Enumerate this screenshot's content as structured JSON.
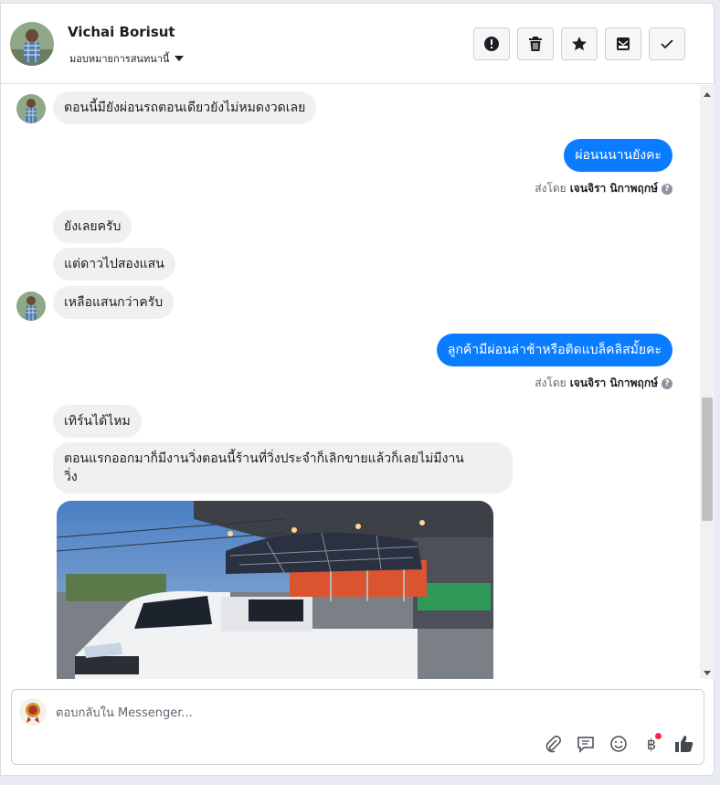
{
  "header": {
    "contact_name": "Vichai Borisut",
    "assign_label": "มอบหมายการสนทนานี้",
    "actions": [
      "spam-icon",
      "trash-icon",
      "star-icon",
      "inbox-icon",
      "check-icon"
    ]
  },
  "messages": [
    {
      "from": "in",
      "text": "ตอนนี้มียังผ่อนรถตอนเดียวยังไม่หมดงวดเลย"
    },
    {
      "from": "out",
      "text": "ผ่อนนนานยังคะ",
      "sent_by_prefix": "ส่งโดย",
      "sent_by_name": "เจนจิรา นิกาพฤกษ์"
    },
    {
      "from": "in",
      "text": "ยังเลยครับ"
    },
    {
      "from": "in",
      "text": "แต่ดาวไปสองแสน"
    },
    {
      "from": "in",
      "text": "เหลือแสนกว่าครับ"
    },
    {
      "from": "out",
      "text": "ลูกค้ามีผ่อนล่าช้าหรือติดแบล็คลิสมั้ยคะ",
      "sent_by_prefix": "ส่งโดย",
      "sent_by_name": "เจนจิรา นิกาพฤกษ์"
    },
    {
      "from": "in",
      "text": "เทิร์นได้ไหม"
    },
    {
      "from": "in",
      "text": "ตอนแรกออกมาก็มีงานวิ่งตอนนี้ร้านที่วิ่งประจำก็เลิกขายแล้วก็เลยไม่มีงาน",
      "text_line2": "วิ่ง"
    }
  ],
  "composer": {
    "placeholder": "ตอบกลับใน Messenger...",
    "tools": [
      "paperclip-icon",
      "saved-reply-icon",
      "emoji-icon",
      "baht-payment-icon",
      "thumbs-up-icon"
    ],
    "baht_symbol": "฿"
  },
  "colors": {
    "outgoing_bubble": "#0a7cff",
    "incoming_bubble": "#f0f0f0",
    "notification_dot": "#f02849"
  }
}
